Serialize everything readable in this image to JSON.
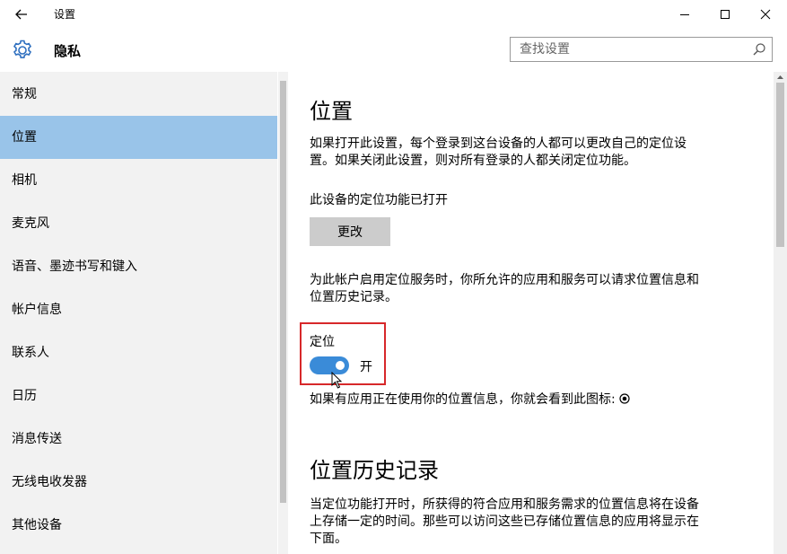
{
  "window": {
    "title": "设置",
    "back_icon": "arrow-left-icon",
    "controls": [
      "minimize-icon",
      "maximize-icon",
      "close-icon"
    ]
  },
  "header": {
    "icon": "gear-icon",
    "title": "隐私",
    "search": {
      "placeholder": "查找设置",
      "value": "",
      "icon": "search-icon"
    }
  },
  "sidebar": {
    "items": [
      {
        "label": "常规",
        "active": false
      },
      {
        "label": "位置",
        "active": true
      },
      {
        "label": "相机",
        "active": false
      },
      {
        "label": "麦克风",
        "active": false
      },
      {
        "label": "语音、墨迹书写和键入",
        "active": false
      },
      {
        "label": "帐户信息",
        "active": false
      },
      {
        "label": "联系人",
        "active": false
      },
      {
        "label": "日历",
        "active": false
      },
      {
        "label": "消息传送",
        "active": false
      },
      {
        "label": "无线电收发器",
        "active": false
      },
      {
        "label": "其他设备",
        "active": false
      }
    ],
    "active_color": "#99c4e9"
  },
  "content": {
    "location": {
      "heading": "位置",
      "description": "如果打开此设置，每个登录到这台设备的人都可以更改自己的定位设置。如果关闭此设置，则对所有登录的人都关闭定位功能。",
      "device_status": "此设备的定位功能已打开",
      "change_button": "更改",
      "account_description": "为此帐户启用定位服务时，你所允许的应用和服务可以请求位置信息和位置历史记录。",
      "toggle": {
        "label": "定位",
        "state_text": "开",
        "on": true,
        "color": "#3a8bd8"
      },
      "icon_note": "如果有应用正在使用你的位置信息，你就会看到此图标:",
      "icon_note_icon": "location-in-use-icon"
    },
    "history": {
      "heading": "位置历史记录",
      "description": "当定位功能打开时，所获得的符合应用和服务需求的位置信息将在设备上存储一定的时间。那些可以访问这些已存储位置信息的应用将显示在下面。"
    }
  },
  "colors": {
    "highlight_border": "#d7282a",
    "button_bg": "#cccccc"
  }
}
